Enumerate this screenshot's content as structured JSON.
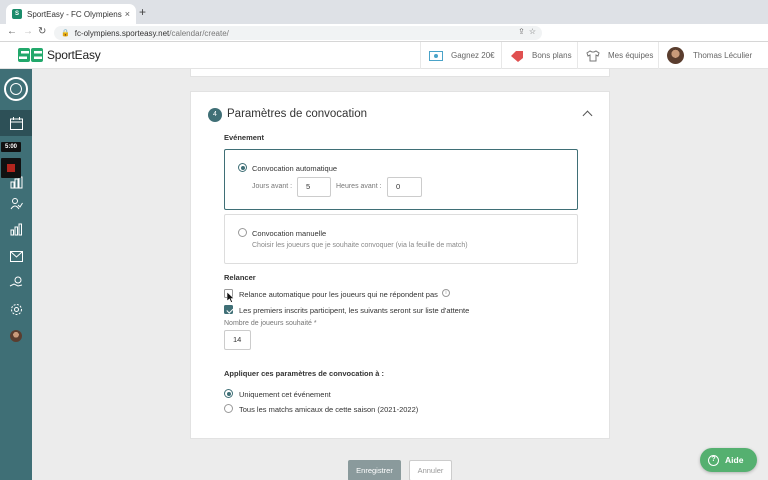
{
  "browser": {
    "tab_title": "SportEasy - FC Olympiens",
    "tab_close": "×",
    "new_tab": "+",
    "url_host": "fc-olympiens.sporteasy.net",
    "url_path": "/calendar/create/"
  },
  "header": {
    "brand": "SportEasy",
    "gagnez": "Gagnez 20€",
    "bons_plans": "Bons plans",
    "mes_equipes": "Mes équipes",
    "user_name": "Thomas Léculier"
  },
  "sidebar": {
    "timer": "5:00"
  },
  "section": {
    "step": "4",
    "title": "Paramètres de convocation",
    "evenement_label": "Evénement",
    "auto": {
      "title": "Convocation automatique",
      "jours_label": "Jours avant :",
      "jours_value": "5",
      "heures_label": "Heures avant :",
      "heures_value": "0"
    },
    "manual": {
      "title": "Convocation manuelle",
      "subtitle": "Choisir les joueurs que je souhaite convoquer (via la feuille de match)"
    },
    "relancer_label": "Relancer",
    "relance_auto": "Relance automatique pour les joueurs qui ne répondent pas",
    "premiers_inscrits": "Les premiers inscrits participent, les suivants seront sur liste d'attente",
    "nb_joueurs_label": "Nombre de joueurs souhaité *",
    "nb_joueurs_value": "14",
    "appliquer_label": "Appliquer ces paramètres de convocation à :",
    "apply_opt1": "Uniquement cet événement",
    "apply_opt2": "Tous les matchs amicaux de cette saison (2021-2022)"
  },
  "actions": {
    "save": "Enregistrer",
    "cancel": "Annuler",
    "help": "Aide"
  },
  "colors": {
    "brand_teal": "#3f6f76",
    "help_green": "#55b070"
  }
}
